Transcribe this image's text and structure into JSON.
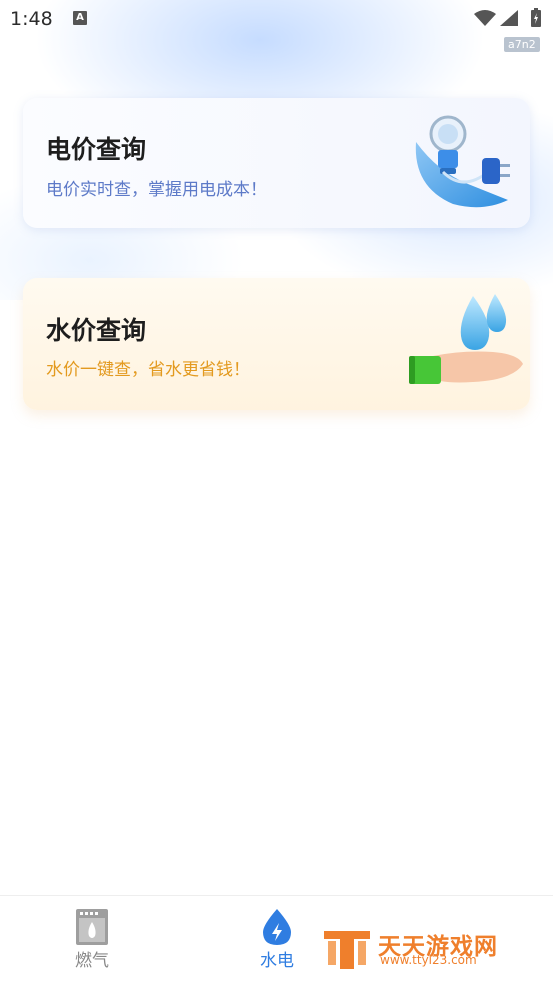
{
  "status_bar": {
    "time": "1:48",
    "notification_icon": "A",
    "build_tag": "a7n2"
  },
  "cards": {
    "electricity": {
      "title": "电价查询",
      "subtitle": "电价实时查，掌握用电成本！",
      "icon": "lightbulb-plug-icon"
    },
    "water": {
      "title": "水价查询",
      "subtitle": "水价一键查，省水更省钱！",
      "icon": "water-drop-hand-icon"
    }
  },
  "bottom_nav": {
    "items": [
      {
        "label": "燃气",
        "icon": "stove-icon",
        "active": false
      },
      {
        "label": "水电",
        "icon": "water-bolt-icon",
        "active": true
      }
    ]
  },
  "watermark": {
    "title": "天天游戏网",
    "url": "www.ttyl23.com"
  },
  "colors": {
    "accent": "#2f7de1",
    "water_subtitle": "#e39a1f",
    "electric_subtitle": "#5d7ac8"
  }
}
